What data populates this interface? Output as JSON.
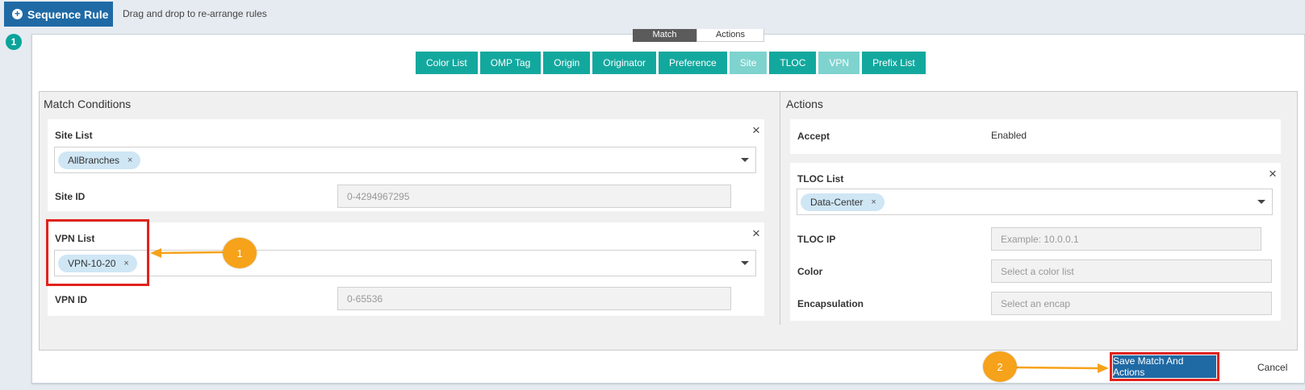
{
  "header": {
    "sequence_rule_label": "Sequence Rule",
    "drag_hint": "Drag and drop to re-arrange rules",
    "sequence_number": "1"
  },
  "tabs": [
    {
      "label": "Match",
      "active": true
    },
    {
      "label": "Actions",
      "active": false
    }
  ],
  "match_chips": [
    {
      "label": "Color List",
      "enabled": true
    },
    {
      "label": "OMP Tag",
      "enabled": true
    },
    {
      "label": "Origin",
      "enabled": true
    },
    {
      "label": "Originator",
      "enabled": true
    },
    {
      "label": "Preference",
      "enabled": true
    },
    {
      "label": "Site",
      "enabled": false
    },
    {
      "label": "TLOC",
      "enabled": true
    },
    {
      "label": "VPN",
      "enabled": false
    },
    {
      "label": "Prefix List",
      "enabled": true
    }
  ],
  "match_conditions": {
    "title": "Match Conditions",
    "site_list": {
      "label": "Site List",
      "tag": "AllBranches",
      "id_label": "Site ID",
      "id_placeholder": "0-4294967295"
    },
    "vpn_list": {
      "label": "VPN List",
      "tag": "VPN-10-20",
      "id_label": "VPN ID",
      "id_placeholder": "0-65536"
    }
  },
  "actions": {
    "title": "Actions",
    "accept": {
      "label": "Accept",
      "value": "Enabled"
    },
    "tloc_list": {
      "label": "TLOC List",
      "tag": "Data-Center",
      "tloc_ip_label": "TLOC IP",
      "tloc_ip_placeholder": "Example: 10.0.0.1",
      "color_label": "Color",
      "color_placeholder": "Select a color list",
      "encap_label": "Encapsulation",
      "encap_placeholder": "Select an encap"
    }
  },
  "footer": {
    "save_label": "Save Match And Actions",
    "cancel_label": "Cancel"
  },
  "callouts": {
    "badge_1": "1",
    "badge_2": "2"
  },
  "colors": {
    "primary": "#1f6aa5",
    "teal": "#13a89e",
    "highlight": "#e0231c",
    "callout": "#f6a21a"
  }
}
